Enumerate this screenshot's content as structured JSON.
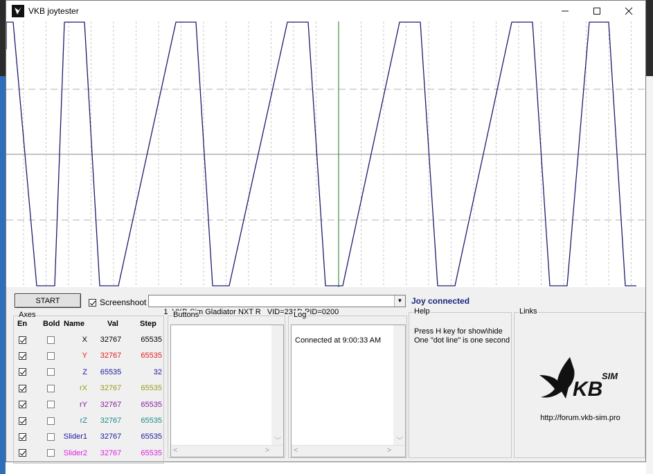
{
  "window": {
    "title": "VKB joytester",
    "min_icon": "minimize-icon",
    "max_icon": "maximize-icon",
    "close_icon": "close-icon"
  },
  "toolbar": {
    "start_label": "START",
    "screenshot_label": "Screenshoot",
    "screenshot_checked": true,
    "device": "1  VKB-Sim Gladiator NXT R   VID=231D PID=0200",
    "status": "Joy connected"
  },
  "axes": {
    "legend": "Axes",
    "headers": {
      "en": "En",
      "bold": "Bold",
      "name": "Name",
      "val": "Val",
      "step": "Step"
    },
    "rows": [
      {
        "en": true,
        "bold": false,
        "name": "X",
        "val": "32767",
        "step": "65535",
        "color": "#000000"
      },
      {
        "en": true,
        "bold": false,
        "name": "Y",
        "val": "32767",
        "step": "65535",
        "color": "#e02020"
      },
      {
        "en": true,
        "bold": false,
        "name": "Z",
        "val": "65535",
        "step": "32",
        "color": "#1a1aa0"
      },
      {
        "en": true,
        "bold": false,
        "name": "rX",
        "val": "32767",
        "step": "65535",
        "color": "#9a9a20"
      },
      {
        "en": true,
        "bold": false,
        "name": "rY",
        "val": "32767",
        "step": "65535",
        "color": "#8a1aa0"
      },
      {
        "en": true,
        "bold": false,
        "name": "rZ",
        "val": "32767",
        "step": "65535",
        "color": "#1a8a8a"
      },
      {
        "en": true,
        "bold": false,
        "name": "Slider1",
        "val": "32767",
        "step": "65535",
        "color": "#1a1aa0"
      },
      {
        "en": true,
        "bold": false,
        "name": "Slider2",
        "val": "32767",
        "step": "65535",
        "color": "#e020e0"
      }
    ]
  },
  "buttons": {
    "legend": "Buttons"
  },
  "log": {
    "legend": "Log",
    "entries": [
      "Connected at 9:00:33 AM"
    ]
  },
  "help": {
    "legend": "Help",
    "line1": "Press H key for show\\hide",
    "line2": "One \"dot line\" is one second"
  },
  "links": {
    "legend": "Links",
    "logo_text": "KB",
    "logo_sup": "SIM",
    "url": "http://forum.vkb-sim.pro"
  },
  "plot": {
    "wave_color": "#1a1a6e",
    "marker_color": "#1a7a1a",
    "grid_color": "#b0b0b0"
  }
}
